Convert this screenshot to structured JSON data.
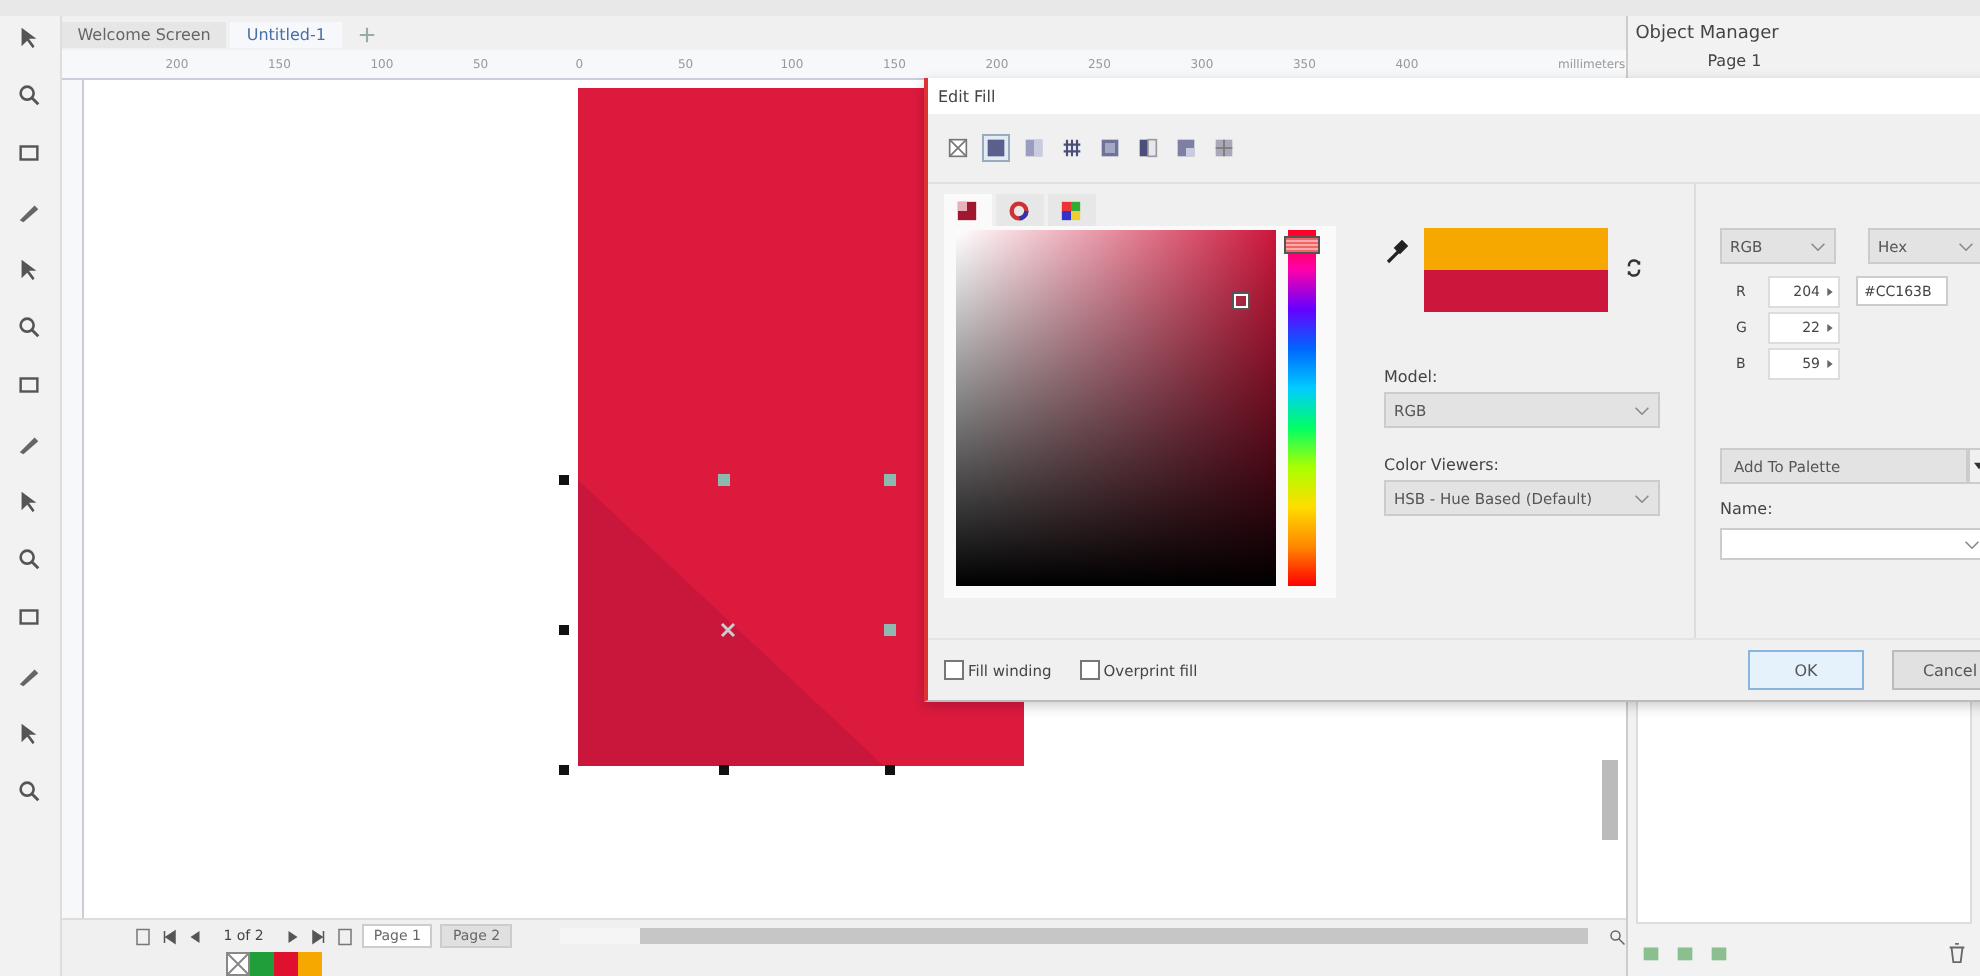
{
  "document_tabs": [
    {
      "label": "Welcome Screen",
      "selected": false
    },
    {
      "label": "Untitled-1",
      "selected": true
    }
  ],
  "ruler": {
    "labels": [
      "200",
      "150",
      "100",
      "50",
      "0",
      "50",
      "100",
      "150",
      "200",
      "250",
      "300",
      "350",
      "400"
    ],
    "unit": "millimeters"
  },
  "object_manager": {
    "title": "Object Manager",
    "page": "Page 1"
  },
  "dialog": {
    "title": "Edit Fill",
    "fill_types": [
      {
        "kind": "none",
        "selected": false
      },
      {
        "kind": "uniform",
        "selected": true
      },
      {
        "kind": "fountain",
        "selected": false
      },
      {
        "kind": "pattern",
        "selected": false
      },
      {
        "kind": "bitmap",
        "selected": false
      },
      {
        "kind": "two-color",
        "selected": false
      },
      {
        "kind": "texture",
        "selected": false
      },
      {
        "kind": "postscript",
        "selected": false
      }
    ],
    "viewer_tabs": [
      {
        "kind": "square",
        "selected": true
      },
      {
        "kind": "wheel",
        "selected": false
      },
      {
        "kind": "palette",
        "selected": false
      }
    ],
    "hue_slider": {
      "level": 0.98
    },
    "model": {
      "label": "Model:",
      "value": "RGB"
    },
    "color_viewers": {
      "label": "Color Viewers:",
      "value": "HSB - Hue Based (Default)"
    },
    "value_mode": "RGB",
    "hex_mode": "Hex",
    "channels": [
      {
        "label": "R",
        "value": "204"
      },
      {
        "label": "G",
        "value": "22"
      },
      {
        "label": "B",
        "value": "59"
      }
    ],
    "hex_value": "#CC163B",
    "add_to_palette": "Add To Palette",
    "name": {
      "label": "Name:"
    },
    "options": [
      {
        "label": "Fill winding",
        "checked": false
      },
      {
        "label": "Overprint fill",
        "checked": false
      }
    ],
    "buttons": [
      {
        "label": "OK",
        "kind": "primary"
      },
      {
        "label": "Cancel",
        "kind": "secondary"
      }
    ]
  },
  "page_navigator": {
    "position": "1 of 2",
    "pages": [
      {
        "label": "Page 1",
        "selected": true
      },
      {
        "label": "Page 2",
        "selected": false
      }
    ]
  },
  "palette": [
    {
      "kind": "none"
    },
    {
      "kind": "color",
      "color": "#1f9e3a"
    },
    {
      "kind": "color",
      "color": "#e0102f"
    },
    {
      "kind": "color",
      "color": "#f7a800"
    }
  ]
}
